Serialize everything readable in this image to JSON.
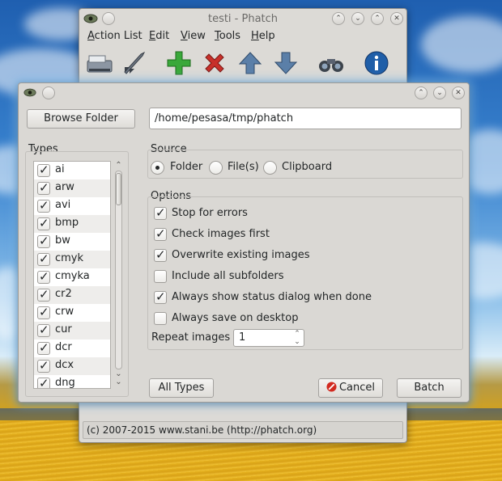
{
  "main_window": {
    "title": "testi - Phatch",
    "menu": [
      "Action List",
      "Edit",
      "View",
      "Tools",
      "Help"
    ],
    "toolbar_icons": [
      "scanner-icon",
      "rocket-icon",
      "add-icon",
      "delete-icon",
      "up-arrow-icon",
      "down-arrow-icon",
      "binoculars-icon",
      "info-icon"
    ],
    "status": "(c) 2007-2015 www.stani.be (http://phatch.org)"
  },
  "dialog": {
    "browse_button": "Browse Folder",
    "path_value": "/home/pesasa/tmp/phatch",
    "types_label": "Types",
    "types": [
      {
        "label": "ai",
        "checked": true
      },
      {
        "label": "arw",
        "checked": true
      },
      {
        "label": "avi",
        "checked": true
      },
      {
        "label": "bmp",
        "checked": true
      },
      {
        "label": "bw",
        "checked": true
      },
      {
        "label": "cmyk",
        "checked": true
      },
      {
        "label": "cmyka",
        "checked": true
      },
      {
        "label": "cr2",
        "checked": true
      },
      {
        "label": "crw",
        "checked": true
      },
      {
        "label": "cur",
        "checked": true
      },
      {
        "label": "dcr",
        "checked": true
      },
      {
        "label": "dcx",
        "checked": true
      },
      {
        "label": "dng",
        "checked": true
      }
    ],
    "source_label": "Source",
    "source_options": [
      {
        "label": "Folder",
        "selected": true
      },
      {
        "label": "File(s)",
        "selected": false
      },
      {
        "label": "Clipboard",
        "selected": false
      }
    ],
    "options_label": "Options",
    "options": [
      {
        "label": "Stop for errors",
        "checked": true
      },
      {
        "label": "Check images first",
        "checked": true
      },
      {
        "label": "Overwrite existing images",
        "checked": true
      },
      {
        "label": "Include all subfolders",
        "checked": false
      },
      {
        "label": "Always show status dialog when done",
        "checked": true
      },
      {
        "label": "Always save on desktop",
        "checked": false
      }
    ],
    "repeat_label": "Repeat images",
    "repeat_value": "1",
    "all_types_button": "All Types",
    "cancel_button": "Cancel",
    "batch_button": "Batch"
  },
  "colors": {
    "add_icon": "#3aa83a",
    "delete_icon": "#c8302a",
    "arrow_icon": "#5b7fa8",
    "info_icon": "#1f5ea8",
    "cancel_icon": "#d22a20"
  }
}
